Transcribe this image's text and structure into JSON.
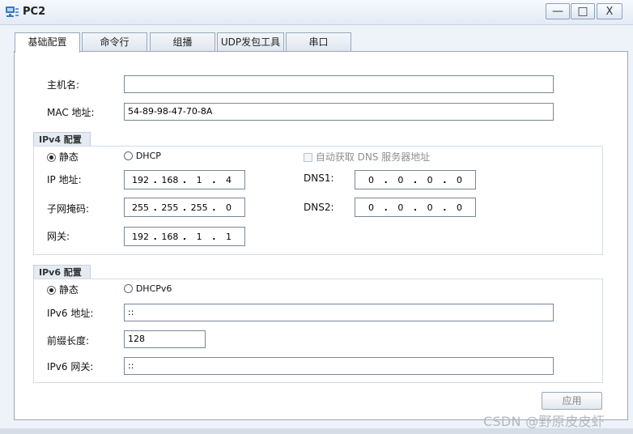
{
  "window": {
    "title": "PC2"
  },
  "tabs": [
    {
      "label": "基础配置"
    },
    {
      "label": "命令行"
    },
    {
      "label": "组播"
    },
    {
      "label": "UDP发包工具"
    },
    {
      "label": "串口"
    }
  ],
  "basic": {
    "hostname_label": "主机名:",
    "hostname_value": "",
    "mac_label": "MAC 地址:",
    "mac_value": "54-89-98-47-70-8A"
  },
  "ipv4": {
    "title": "IPv4 配置",
    "static_label": "静态",
    "dhcp_label": "DHCP",
    "auto_dns_label": "自动获取 DNS 服务器地址",
    "ip_label": "IP 地址:",
    "ip": [
      "192",
      "168",
      "1",
      "4"
    ],
    "mask_label": "子网掩码:",
    "mask": [
      "255",
      "255",
      "255",
      "0"
    ],
    "gateway_label": "网关:",
    "gateway": [
      "192",
      "168",
      "1",
      "1"
    ],
    "dns1_label": "DNS1:",
    "dns1": [
      "0",
      "0",
      "0",
      "0"
    ],
    "dns2_label": "DNS2:",
    "dns2": [
      "0",
      "0",
      "0",
      "0"
    ]
  },
  "ipv6": {
    "title": "IPv6 配置",
    "static_label": "静态",
    "dhcp_label": "DHCPv6",
    "addr_label": "IPv6 地址:",
    "addr_value": "::",
    "prefix_label": "前缀长度:",
    "prefix_value": "128",
    "gateway_label": "IPv6 网关:",
    "gateway_value": "::"
  },
  "apply_label": "应用",
  "watermark": "CSDN @野原皮皮虾"
}
